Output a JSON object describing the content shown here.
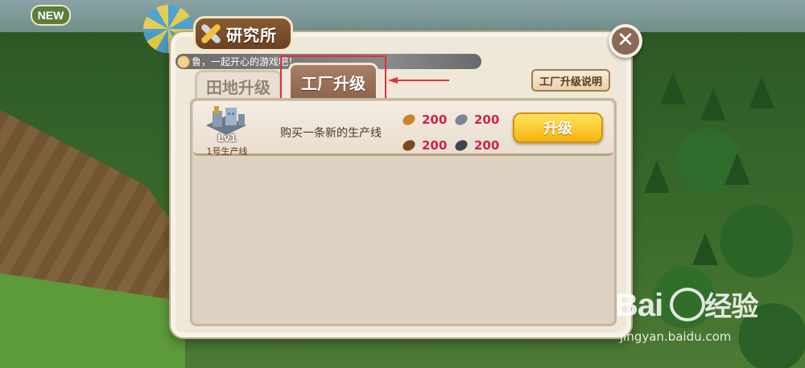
{
  "world": {
    "new_badge": "NEW"
  },
  "dialog": {
    "title": "研究所",
    "close_icon": "close-icon",
    "marquee": "鲁，一起开心的游戏吧！",
    "tabs": [
      {
        "label": "田地升级",
        "active": false
      },
      {
        "label": "工厂升级",
        "active": true
      }
    ],
    "help_button": "工厂升级说明",
    "row": {
      "level": "Lv1",
      "line_name": "1号生产线",
      "description": "购买一条新的生产线",
      "costs": [
        {
          "icon": "wood-plank-icon",
          "color": "#c8862a",
          "value": "200"
        },
        {
          "icon": "stone-icon",
          "color": "#7d8590",
          "value": "200"
        },
        {
          "icon": "brick-icon",
          "color": "#7a4a22",
          "value": "200"
        },
        {
          "icon": "iron-icon",
          "color": "#3e4452",
          "value": "200"
        }
      ],
      "upgrade_button": "升级"
    }
  },
  "colors": {
    "annotation": "#e2303a",
    "button_yellow": "#f5b410",
    "cost_text": "#d0224a"
  },
  "watermark": {
    "logo_left": "Bai",
    "logo_right": "经验",
    "url": "jingyan.baidu.com"
  }
}
